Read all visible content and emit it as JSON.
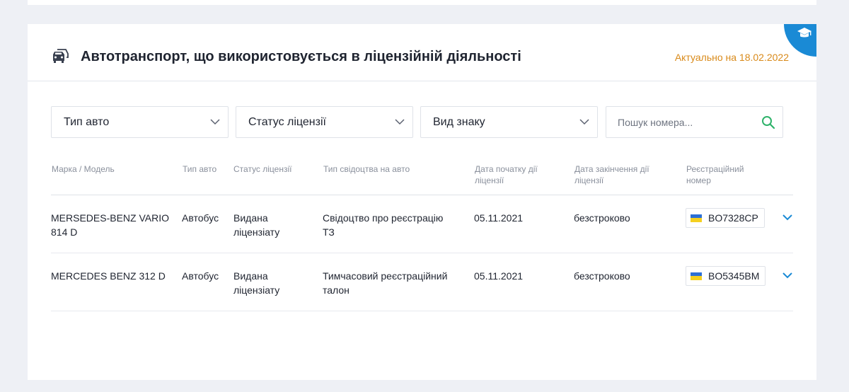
{
  "header": {
    "title": "Автотранспорт, що використовується в ліцензійній діяльності",
    "actual_date": "Актуально на 18.02.2022"
  },
  "filters": {
    "vehicle_type": "Тип авто",
    "license_status": "Статус ліцензії",
    "sign_type": "Вид знаку",
    "search_placeholder": "Пошук номера..."
  },
  "table": {
    "columns": {
      "make_model": "Марка / Модель",
      "vehicle_type": "Тип авто",
      "license_status": "Статус ліцензії",
      "certificate_type": "Тип свідоцтва на авто",
      "start_date_l1": "Дата початку дії",
      "start_date_l2": "ліцензії",
      "end_date_l1": "Дата закінчення дії",
      "end_date_l2": "ліцензії",
      "reg_number_l1": "Реєстраційний",
      "reg_number_l2": "номер"
    },
    "rows": [
      {
        "model_l1": "MERSEDES-BENZ VARIO",
        "model_l2": "814 D",
        "type": "Автобус",
        "status_l1": "Видана",
        "status_l2": "ліцензіату",
        "cert_l1": "Свідоцтво про реєстрацію",
        "cert_l2": "ТЗ",
        "start": "05.11.2021",
        "end": "безстроково",
        "plate": "BO7328CP"
      },
      {
        "model_l1": "MERCEDES BENZ 312 D",
        "model_l2": "",
        "type": "Автобус",
        "status_l1": "Видана",
        "status_l2": "ліцензіату",
        "cert_l1": "Тимчасовий реєстраційний",
        "cert_l2": "талон",
        "start": "05.11.2021",
        "end": "безстроково",
        "plate": "BO5345BM"
      }
    ]
  },
  "colors": {
    "accent": "#1a8ad5",
    "date": "#d98a1a",
    "search_icon": "#2fb36b"
  },
  "icons": [
    "graduation-cap-icon",
    "car-icon",
    "chevron-down-icon",
    "search-icon",
    "ukraine-flag-icon"
  ]
}
